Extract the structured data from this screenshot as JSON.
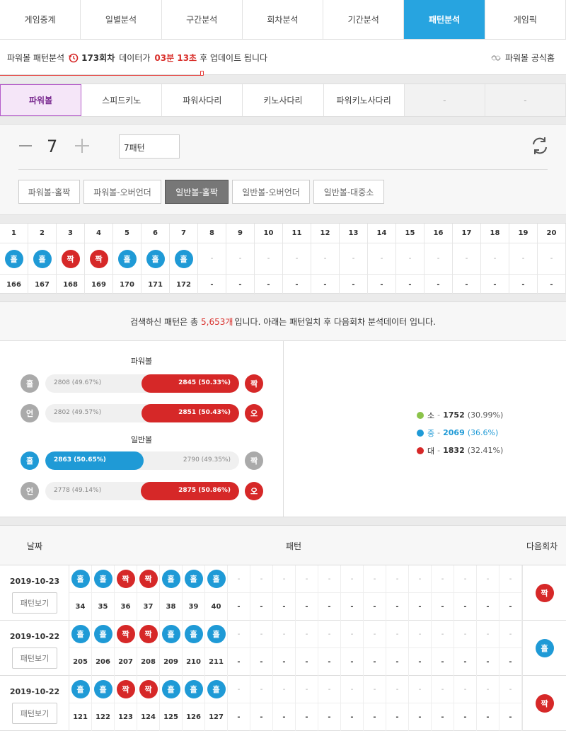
{
  "top_tabs": [
    "게임중계",
    "일별분석",
    "구간분석",
    "회차분석",
    "기간분석",
    "패턴분석",
    "게임픽"
  ],
  "top_active": 5,
  "info": {
    "prefix": "파워볼 패턴분석",
    "round": "173회차",
    "mid": "데이터가",
    "time": "03분 13초",
    "suffix": "후 업데이트 됩니다",
    "official": "파워볼 공식홈"
  },
  "game_tabs": [
    "파워볼",
    "스피드키노",
    "파워사다리",
    "키노사다리",
    "파워키노사다리",
    "-",
    "-"
  ],
  "game_active": 0,
  "control": {
    "minus": "−",
    "count": "7",
    "plus": "+",
    "pattern_input": "7패턴",
    "buttons": [
      "파워볼-홀짝",
      "파워볼-오버언더",
      "일반볼-홀짝",
      "일반볼-오버언더",
      "일반볼-대중소"
    ],
    "active_button": 2
  },
  "pattern": {
    "headers": [
      "1",
      "2",
      "3",
      "4",
      "5",
      "6",
      "7",
      "8",
      "9",
      "10",
      "11",
      "12",
      "13",
      "14",
      "15",
      "16",
      "17",
      "18",
      "19",
      "20"
    ],
    "balls": [
      "홀",
      "홀",
      "짝",
      "짝",
      "홀",
      "홀",
      "홀",
      "-",
      "-",
      "-",
      "-",
      "-",
      "-",
      "-",
      "-",
      "-",
      "-",
      "-",
      "-",
      "-"
    ],
    "ball_colors": [
      "blue",
      "blue",
      "red",
      "red",
      "blue",
      "blue",
      "blue"
    ],
    "rounds": [
      "166",
      "167",
      "168",
      "169",
      "170",
      "171",
      "172",
      "-",
      "-",
      "-",
      "-",
      "-",
      "-",
      "-",
      "-",
      "-",
      "-",
      "-",
      "-",
      "-"
    ]
  },
  "summary": {
    "before": "검색하신 패턴은 총",
    "count": "5,653개",
    "after": "입니다. 아래는 패턴일치 후 다음회차 분석데이터 입니다."
  },
  "stats": {
    "powerball_title": "파워볼",
    "normal_title": "일반볼",
    "rows": [
      {
        "left_ball": "홀",
        "left_color": "gray",
        "left": "2808 (49.67%)",
        "right": "2845 (50.33%)",
        "right_ball": "짝",
        "right_color": "red",
        "left_pct": 49.67,
        "winner": "right",
        "fill": "red"
      },
      {
        "left_ball": "언",
        "left_color": "gray",
        "left": "2802 (49.57%)",
        "right": "2851 (50.43%)",
        "right_ball": "오",
        "right_color": "red",
        "left_pct": 49.57,
        "winner": "right",
        "fill": "red"
      },
      {
        "left_ball": "홀",
        "left_color": "blue",
        "left": "2863 (50.65%)",
        "right": "2790 (49.35%)",
        "right_ball": "짝",
        "right_color": "gray",
        "left_pct": 50.65,
        "winner": "left",
        "fill": "blue"
      },
      {
        "left_ball": "언",
        "left_color": "gray",
        "left": "2778 (49.14%)",
        "right": "2875 (50.86%)",
        "right_ball": "오",
        "right_color": "red",
        "left_pct": 49.14,
        "winner": "right",
        "fill": "red"
      }
    ],
    "sizes": [
      {
        "label": "소",
        "sep": "-",
        "value": "1752",
        "pct": "(30.99%)",
        "color": "#8bc34a",
        "highlight": false
      },
      {
        "label": "중",
        "sep": "-",
        "value": "2069",
        "pct": "(36.6%)",
        "color": "#1f9ad6",
        "highlight": true
      },
      {
        "label": "대",
        "sep": "-",
        "value": "1832",
        "pct": "(32.41%)",
        "color": "#d62828",
        "highlight": false
      }
    ]
  },
  "history": {
    "header_date": "날짜",
    "header_pattern": "패턴",
    "header_next": "다음회차",
    "view_label": "패턴보기",
    "rows": [
      {
        "date": "2019-10-23",
        "balls": [
          "홀",
          "홀",
          "짝",
          "짝",
          "홀",
          "홀",
          "홀"
        ],
        "colors": [
          "blue",
          "blue",
          "red",
          "red",
          "blue",
          "blue",
          "blue"
        ],
        "rounds": [
          "34",
          "35",
          "36",
          "37",
          "38",
          "39",
          "40"
        ],
        "next": "짝",
        "next_color": "red"
      },
      {
        "date": "2019-10-22",
        "balls": [
          "홀",
          "홀",
          "짝",
          "짝",
          "홀",
          "홀",
          "홀"
        ],
        "colors": [
          "blue",
          "blue",
          "red",
          "red",
          "blue",
          "blue",
          "blue"
        ],
        "rounds": [
          "205",
          "206",
          "207",
          "208",
          "209",
          "210",
          "211"
        ],
        "next": "홀",
        "next_color": "blue"
      },
      {
        "date": "2019-10-22",
        "balls": [
          "홀",
          "홀",
          "짝",
          "짝",
          "홀",
          "홀",
          "홀"
        ],
        "colors": [
          "blue",
          "blue",
          "red",
          "red",
          "blue",
          "blue",
          "blue"
        ],
        "rounds": [
          "121",
          "122",
          "123",
          "124",
          "125",
          "126",
          "127"
        ],
        "next": "짝",
        "next_color": "red"
      }
    ]
  }
}
